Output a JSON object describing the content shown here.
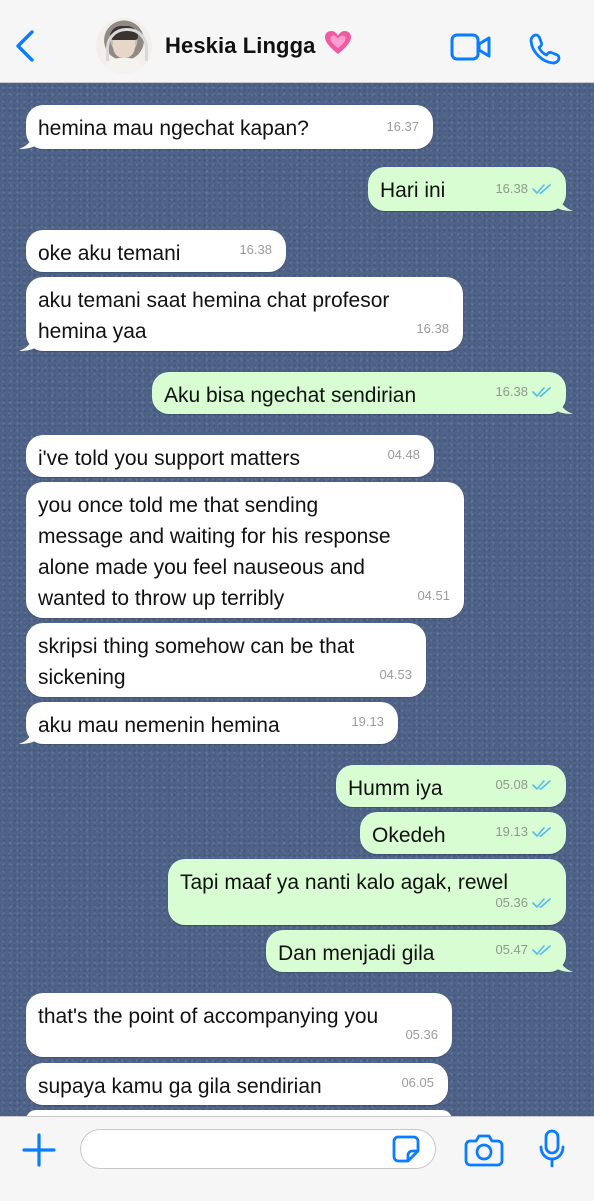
{
  "header": {
    "contact_name": "Heskia Lingga",
    "heart_emoji": "💓",
    "icons": [
      "chevron-left-icon",
      "avatar",
      "video-icon",
      "phone-icon"
    ],
    "accent_color": "#0a7cff"
  },
  "messages": [
    {
      "dir": "in",
      "text": "hemina mau ngechat kapan?",
      "time": "16.37"
    },
    {
      "dir": "out",
      "text": "Hari ini",
      "time": "16.38",
      "read": true
    },
    {
      "dir": "in",
      "text": "oke aku temani",
      "time": "16.38"
    },
    {
      "dir": "in",
      "text": "aku temani saat hemina chat profesor\nhemina yaa",
      "time": "16.38"
    },
    {
      "dir": "out",
      "text": "Aku bisa ngechat sendirian",
      "time": "16.38",
      "read": true
    },
    {
      "dir": "in",
      "text": "i've told you support matters",
      "time": "04.48"
    },
    {
      "dir": "in",
      "text": "you once told me that sending\nmessage and waiting for his response\nalone made you feel nauseous and\nwanted to throw up terribly",
      "time": "04.51"
    },
    {
      "dir": "in",
      "text": "skripsi thing somehow can be that\nsickening",
      "time": "04.53"
    },
    {
      "dir": "in",
      "text": "aku mau nemenin hemina",
      "time": "19.13"
    },
    {
      "dir": "out",
      "text": "Humm iya",
      "time": "05.08",
      "read": true
    },
    {
      "dir": "out",
      "text": "Okedeh",
      "time": "19.13",
      "read": true
    },
    {
      "dir": "out",
      "text": "Tapi maaf ya nanti kalo agak, rewel",
      "time": "05.36",
      "read": true
    },
    {
      "dir": "out",
      "text": "Dan menjadi gila",
      "time": "05.47",
      "read": true
    },
    {
      "dir": "in",
      "text": "that's the point of accompanying you",
      "time": "05.36"
    },
    {
      "dir": "in",
      "text": "supaya kamu ga gila sendirian",
      "time": "06.05"
    }
  ],
  "composer": {
    "input_value": "",
    "icons": [
      "plus-icon",
      "sticker-icon",
      "camera-icon",
      "mic-icon"
    ]
  },
  "colors": {
    "incoming_bubble": "#ffffff",
    "outgoing_bubble": "#d9fdd3",
    "read_ticks": "#53bdeb",
    "chat_background": "#4f6389"
  }
}
